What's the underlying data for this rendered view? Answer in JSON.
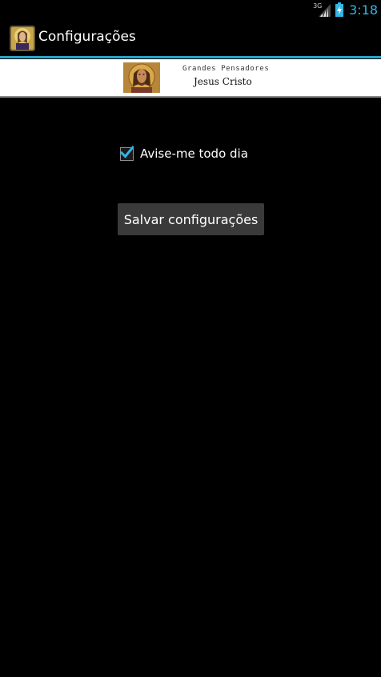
{
  "status_bar": {
    "network_label": "3G",
    "time": "3:18",
    "icons": [
      "signal-icon",
      "battery-charging-icon"
    ],
    "accent_color": "#33b5e5"
  },
  "action_bar": {
    "icon": "jesus-portrait-icon",
    "title": "Configurações",
    "divider_color": "#2aa3c7"
  },
  "banner": {
    "line1": "Grandes Pensadores",
    "line2": "Jesus Cristo",
    "image": "jesus-icon-image"
  },
  "settings": {
    "daily_reminder": {
      "label": "Avise-me todo dia",
      "checked": true,
      "check_color": "#33b5e5"
    },
    "save_button": {
      "label": "Salvar configurações"
    }
  }
}
